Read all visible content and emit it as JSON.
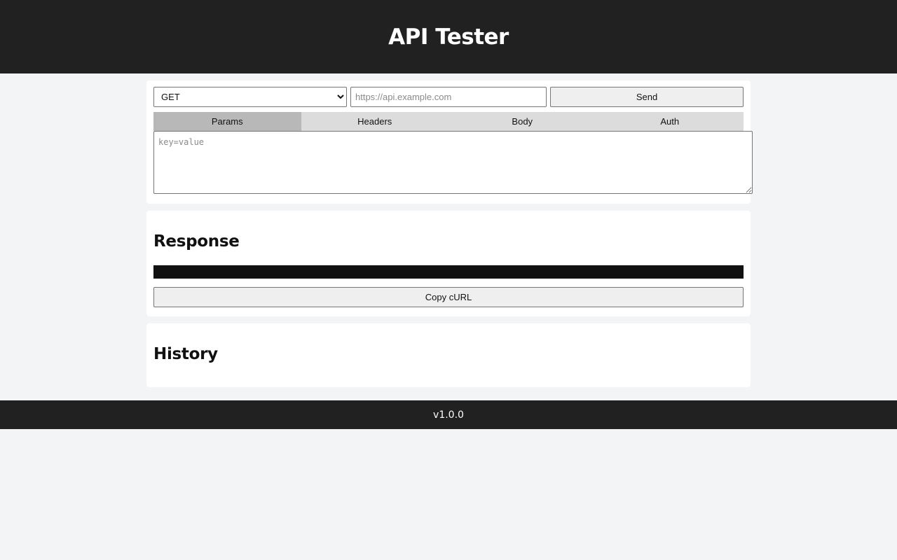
{
  "header": {
    "title": "API Tester"
  },
  "request": {
    "method_options": [
      "GET"
    ],
    "method_selected": "GET",
    "url_value": "",
    "url_placeholder": "https://api.example.com",
    "send_label": "Send",
    "tabs": [
      {
        "label": "Params",
        "active": true
      },
      {
        "label": "Headers",
        "active": false
      },
      {
        "label": "Body",
        "active": false
      },
      {
        "label": "Auth",
        "active": false
      }
    ],
    "editor_value": "",
    "editor_placeholder": "key=value"
  },
  "response": {
    "title": "Response",
    "output": "",
    "copy_curl_label": "Copy cURL"
  },
  "history": {
    "title": "History",
    "items": []
  },
  "footer": {
    "version": "v1.0.0"
  },
  "colors": {
    "header_bg": "#212121",
    "page_bg": "#f3f4f6",
    "tab_active": "#b8b8b8",
    "tab_inactive": "#dcdcdc",
    "response_bg": "#111111"
  }
}
